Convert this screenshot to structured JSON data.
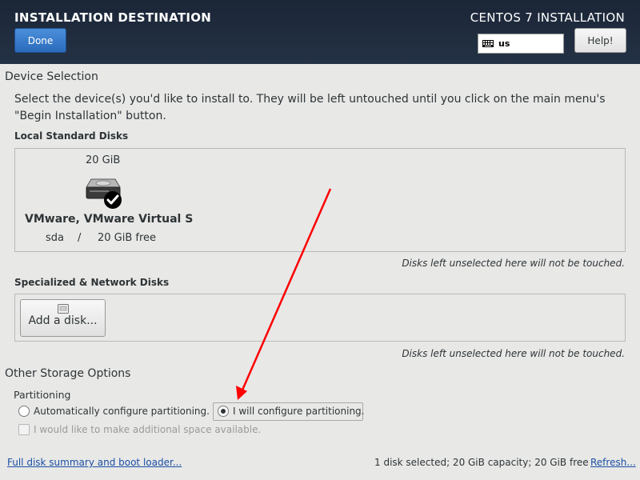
{
  "header": {
    "spoke_title": "INSTALLATION DESTINATION",
    "product_title": "CENTOS 7 INSTALLATION",
    "done_label": "Done",
    "help_label": "Help!",
    "keyboard_layout": "us"
  },
  "device_selection": {
    "heading": "Device Selection",
    "description": "Select the device(s) you'd like to install to.  They will be left untouched until you click on the main menu's \"Begin Installation\" button.",
    "local_disks_heading": "Local Standard Disks",
    "local_disks": [
      {
        "size": "20 GiB",
        "name": "VMware, VMware Virtual S",
        "device": "sda",
        "separator": "/",
        "free": "20 GiB free",
        "selected": true
      }
    ],
    "local_note": "Disks left unselected here will not be touched.",
    "network_disks_heading": "Specialized & Network Disks",
    "add_disk_label": "Add a disk...",
    "network_note": "Disks left unselected here will not be touched."
  },
  "other_storage": {
    "heading": "Other Storage Options",
    "partitioning_heading": "Partitioning",
    "auto_label": "Automatically configure partitioning.",
    "auto_selected": false,
    "manual_label": "I will configure partitioning.",
    "manual_selected": true,
    "extra_space_label": "I would like to make additional space available.",
    "extra_space_checked": false
  },
  "footer": {
    "summary_link": "Full disk summary and boot loader...",
    "status": "1 disk selected; 20 GiB capacity; 20 GiB free",
    "refresh_link": "Refresh..."
  },
  "colors": {
    "header_bg": "#1b2637",
    "done_button": "#2b6bbd",
    "link": "#1a4fa3",
    "annotation_arrow": "#ff0000"
  }
}
